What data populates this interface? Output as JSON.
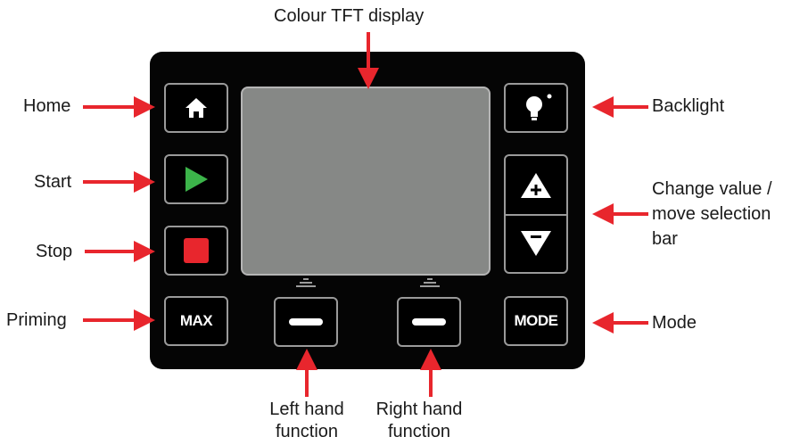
{
  "labels": {
    "display": "Colour TFT display",
    "home": "Home",
    "start": "Start",
    "stop": "Stop",
    "priming": "Priming",
    "backlight": "Backlight",
    "change_value_1": "Change value /",
    "change_value_2": "move selection",
    "change_value_3": "bar",
    "mode": "Mode",
    "left_1": "Left hand",
    "left_2": "function",
    "right_1": "Right hand",
    "right_2": "function"
  },
  "buttons": {
    "max": "MAX",
    "mode": "MODE"
  },
  "colors": {
    "arrow": "#e8262d",
    "panel": "#050505",
    "screen": "#868886",
    "start_green": "#3cb44a",
    "stop_red": "#e8262d"
  },
  "icons": [
    "home-icon",
    "play-icon",
    "stop-icon",
    "lightbulb-icon",
    "plus-icon",
    "minus-icon"
  ]
}
